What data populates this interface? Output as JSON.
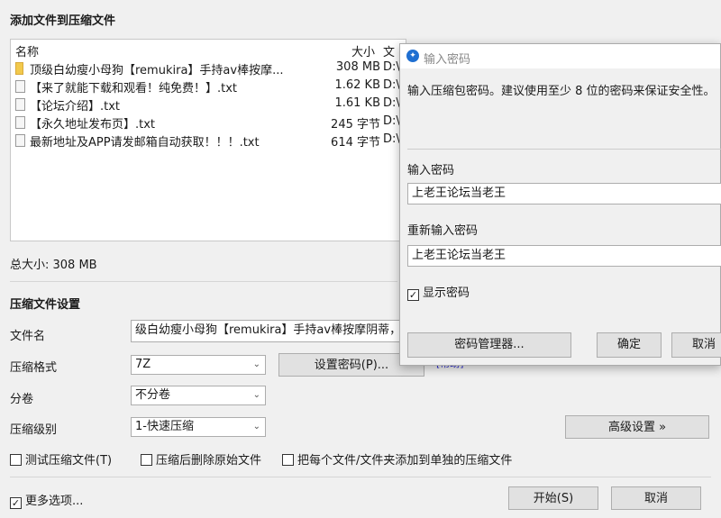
{
  "window": {
    "title": "添加文件到压缩文件"
  },
  "list": {
    "headers": {
      "name": "名称",
      "size": "大小",
      "path": "文"
    },
    "rows": [
      {
        "name": "顶级白幼瘦小母狗【remukira】手持av棒按摩...",
        "size": "308 MB",
        "path": "D:\\",
        "type": "folder"
      },
      {
        "name": "【来了就能下载和观看！纯免费！】.txt",
        "size": "1.62 KB",
        "path": "D:\\",
        "type": "file"
      },
      {
        "name": "【论坛介绍】.txt",
        "size": "1.61 KB",
        "path": "D:\\",
        "type": "file"
      },
      {
        "name": "【永久地址发布页】.txt",
        "size": "245 字节",
        "path": "D:\\",
        "type": "file"
      },
      {
        "name": "最新地址及APP请发邮箱自动获取！！！.txt",
        "size": "614 字节",
        "path": "D:\\",
        "type": "file"
      }
    ]
  },
  "total_size": "总大小: 308 MB",
  "settings": {
    "heading": "压缩文件设置",
    "filename_label": "文件名",
    "filename_value": "级白幼瘦小母狗【remukira】手持av棒按摩阴蒂，驱",
    "format_label": "压缩格式",
    "format_value": "7Z",
    "set_password": "设置密码(P)...",
    "help_link": "[帮助]",
    "volume_label": "分卷",
    "volume_value": "不分卷",
    "level_label": "压缩级别",
    "level_value": "1-快速压缩",
    "advanced": "高级设置 »",
    "test_cb": "测试压缩文件(T)",
    "delete_cb": "压缩后删除原始文件",
    "separate_cb": "把每个文件/文件夹添加到单独的压缩文件",
    "more_cb": "更多选项...",
    "start": "开始(S)",
    "cancel": "取消"
  },
  "dialog": {
    "title": "输入密码",
    "desc": "输入压缩包密码。建议使用至少 8 位的密码来保证安全性。",
    "pw_label": "输入密码",
    "pw_value": "上老王论坛当老王",
    "pw2_label": "重新输入密码",
    "pw2_value": "上老王论坛当老王",
    "show_cb": "显示密码",
    "manager": "密码管理器...",
    "ok": "确定",
    "cancel": "取消"
  }
}
